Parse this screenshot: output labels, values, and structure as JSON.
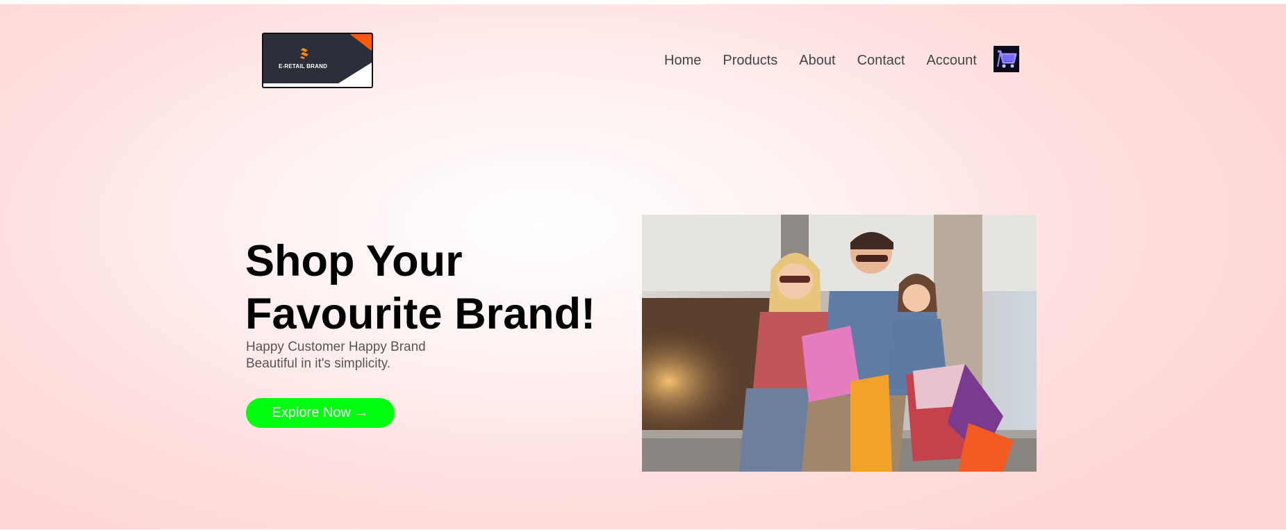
{
  "header": {
    "logo_text": "E-RETAIL BRAND",
    "nav": [
      {
        "label": "Home"
      },
      {
        "label": "Products"
      },
      {
        "label": "About"
      },
      {
        "label": "Contact"
      },
      {
        "label": "Account"
      }
    ],
    "cart_icon": "shopping-cart-icon"
  },
  "hero": {
    "title_line1": "Shop Your",
    "title_line2": "Favourite Brand!",
    "subtitle_line1": "Happy Customer Happy Brand",
    "subtitle_line2": "Beautiful in it's simplicity.",
    "cta_label": "Explore Now →",
    "image": "family-shopping-photo"
  },
  "colors": {
    "background": "#ffe0e0",
    "cta": "#00ff0f",
    "logo_dark": "#2b2f3a",
    "logo_accent": "#ff5a0a"
  }
}
